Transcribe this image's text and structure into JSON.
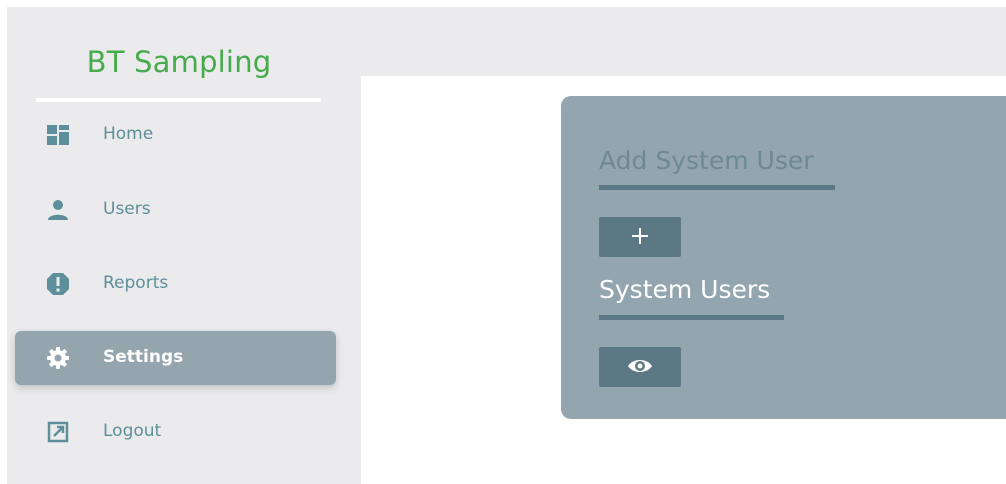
{
  "brand": {
    "title": "BT Sampling",
    "color": "#46ab4a"
  },
  "sidebar": {
    "items": [
      {
        "label": "Home",
        "icon": "dashboard-icon",
        "active": false
      },
      {
        "label": "Users",
        "icon": "user-icon",
        "active": false
      },
      {
        "label": "Reports",
        "icon": "alert-icon",
        "active": false
      },
      {
        "label": "Settings",
        "icon": "gear-icon",
        "active": true
      },
      {
        "label": "Logout",
        "icon": "external-link-icon",
        "active": false
      }
    ]
  },
  "card": {
    "add_title": "Add System User",
    "add_button_icon": "plus-icon",
    "users_title": "System Users",
    "view_button_icon": "eye-icon"
  },
  "colors": {
    "accent": "#5c8f99",
    "card_bg": "#93a5ae",
    "button_bg": "#5c7884",
    "active_bg": "#94a5ae"
  }
}
